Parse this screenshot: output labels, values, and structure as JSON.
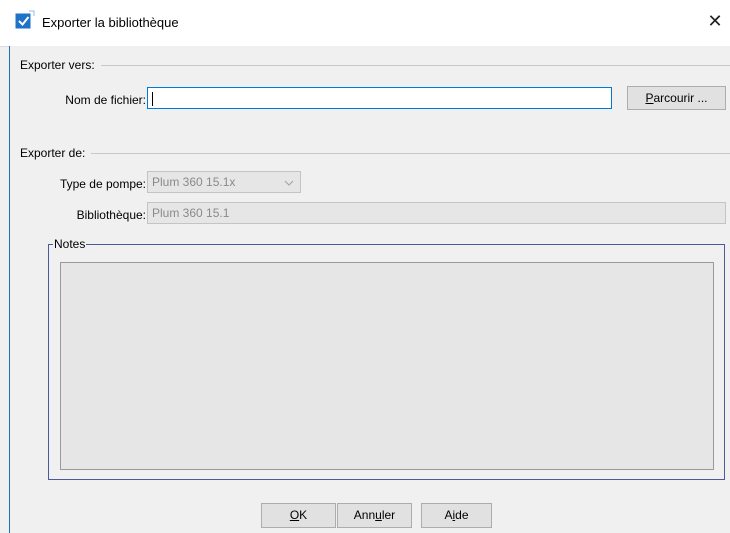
{
  "window": {
    "title": "Exporter la bibliothèque",
    "close_glyph": "✕",
    "title_icon": "checkbox-icon"
  },
  "export_to": {
    "section_label": "Exporter vers:",
    "filename_label": "Nom de fichier:",
    "filename_value": "",
    "browse_label_prefix": "",
    "browse_label_mnemonic": "P",
    "browse_label_rest": "arcourir ..."
  },
  "export_from": {
    "section_label": "Exporter de:",
    "pump_type_label": "Type de pompe:",
    "pump_type_value": "Plum 360 15.1x",
    "library_label": "Bibliothèque:",
    "library_value": "Plum 360 15.1"
  },
  "notes": {
    "legend": "Notes",
    "value": ""
  },
  "buttons": {
    "ok_mnemonic": "O",
    "ok_rest": "K",
    "cancel_prefix": "Ann",
    "cancel_mnemonic": "u",
    "cancel_rest": "ler",
    "help_prefix": "A",
    "help_mnemonic": "i",
    "help_rest": "de"
  },
  "colors": {
    "accent": "#0078d7",
    "window_bg": "#f0f0f0",
    "notes_border": "#4a5a9a"
  }
}
